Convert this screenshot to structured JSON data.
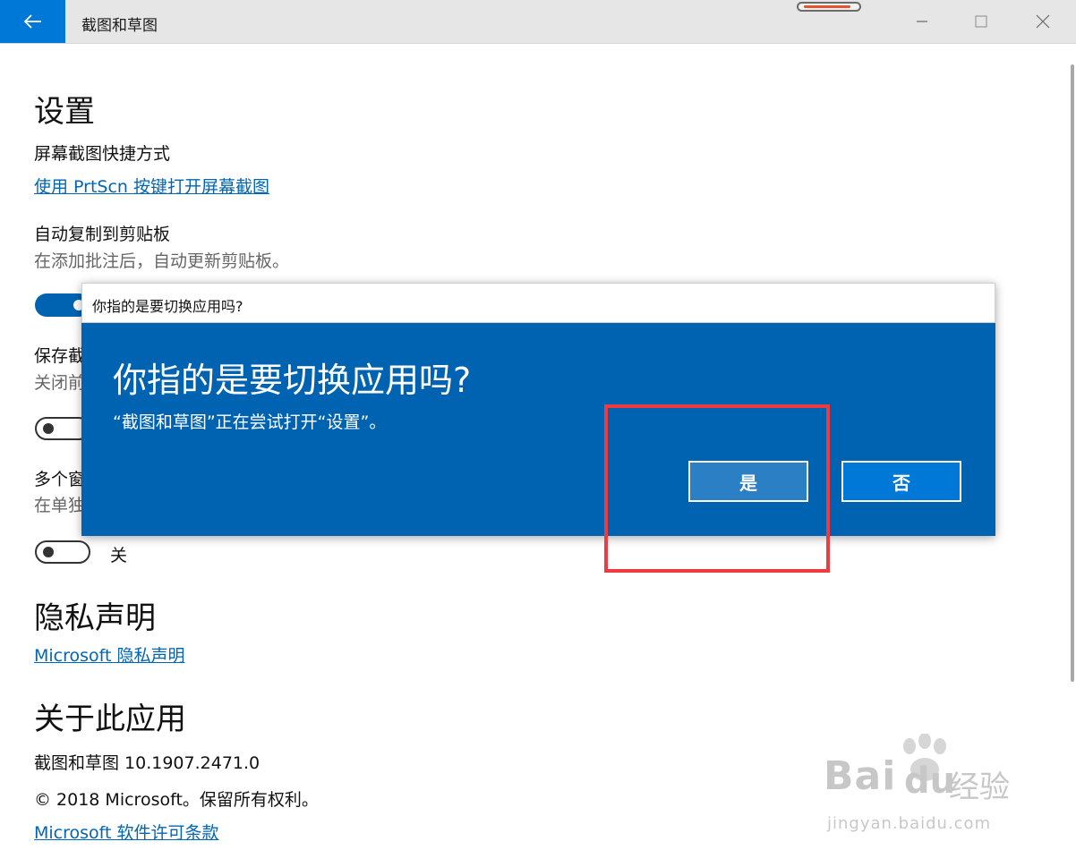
{
  "window": {
    "title": "截图和草图"
  },
  "settings": {
    "heading": "设置",
    "shortcut_label": "屏幕截图快捷方式",
    "shortcut_link": "使用 PrtScn 按键打开屏幕截图",
    "clipboard_label": "自动复制到剪贴板",
    "clipboard_desc": "在添加批注后，自动更新剪贴板。",
    "save_label_partial": "保存截",
    "save_desc_partial": "关闭前",
    "multi_label_partial": "多个窗",
    "multi_desc_partial": "在单独",
    "toggle_state_off": "关"
  },
  "privacy": {
    "heading": "隐私声明",
    "link": "Microsoft 隐私声明"
  },
  "about": {
    "heading": "关于此应用",
    "version": "截图和草图 10.1907.2471.0",
    "copyright": "© 2018 Microsoft。保留所有权利。",
    "license_link": "Microsoft 软件许可条款"
  },
  "dialog": {
    "bar_title": "你指的是要切换应用吗?",
    "heading": "你指的是要切换应用吗?",
    "message": "“截图和草图”正在尝试打开“设置”。",
    "yes_label": "是",
    "no_label": "否"
  },
  "watermark": {
    "brand": "Bai",
    "brand_cn": "经验",
    "url": "jingyan.baidu.com"
  },
  "colors": {
    "accent": "#0078d7",
    "dialog_bg": "#0063b1",
    "link": "#0066b4",
    "highlight": "#ef3b40"
  }
}
